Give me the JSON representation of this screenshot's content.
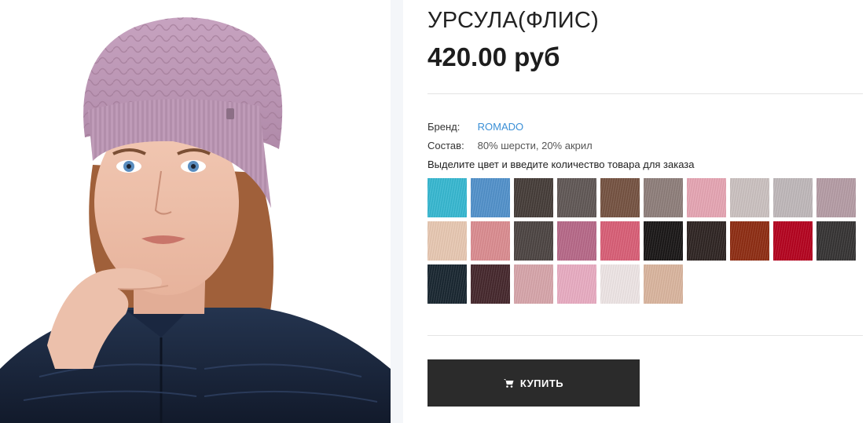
{
  "product": {
    "title": "УРСУЛА(ФЛИС)",
    "price": "420.00 руб",
    "image_icon": "product-photo-woman-knit-hat"
  },
  "details": {
    "brand_label": "Бренд:",
    "brand_value": "ROMADO",
    "composition_label": "Состав:",
    "composition_value": "80% шерсти, 20% акрил",
    "hint": "Выделите цвет и введите количество товара для заказа"
  },
  "swatches": [
    "#34b6cf",
    "#4f8fc9",
    "#433a36",
    "#5e5553",
    "#73503f",
    "#8c7c78",
    "#e4a3b1",
    "#c9bfbe",
    "#bdb6b8",
    "#b39aa3",
    "#e6c6b0",
    "#d98a8e",
    "#4a4240",
    "#b56686",
    "#d75c74",
    "#171414",
    "#2c2220",
    "#8c2a10",
    "#b3001c",
    "#333131",
    "#16242e",
    "#43252a",
    "#d5a3a8",
    "#e7aac0",
    "#ece3e3",
    "#d8b39c"
  ],
  "buy_button": {
    "label": "КУПИТЬ",
    "icon": "cart-icon"
  },
  "colors": {
    "accent_link": "#3a8fd6",
    "button_bg": "#2b2b2b"
  }
}
